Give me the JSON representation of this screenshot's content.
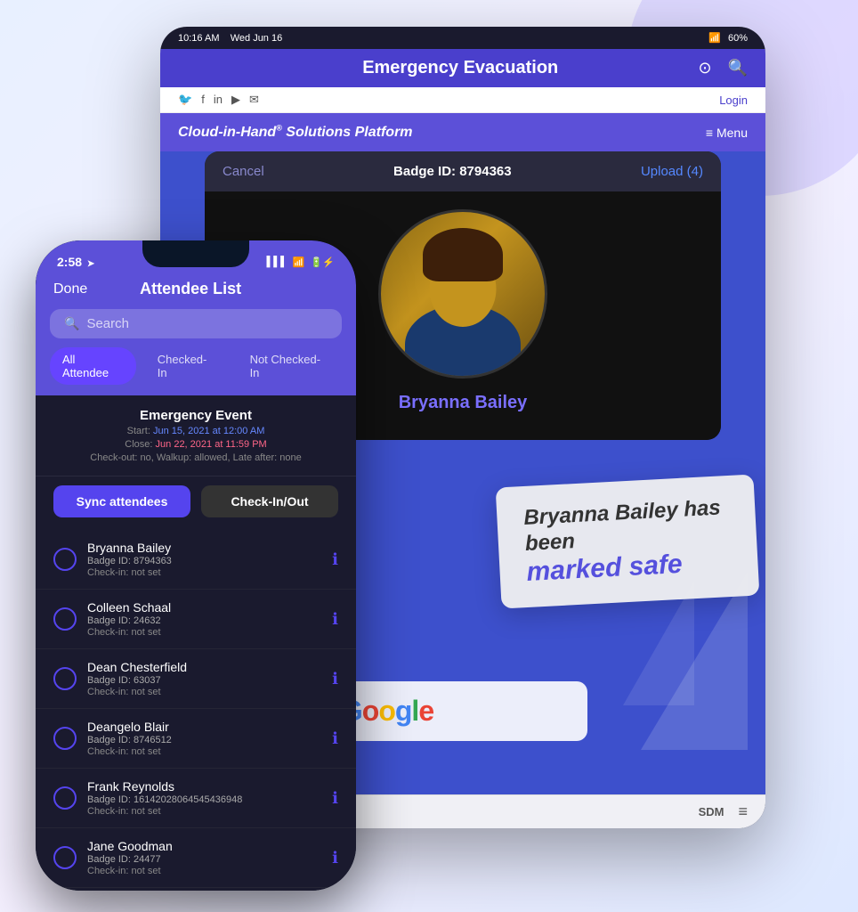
{
  "page": {
    "background": "#e8f0ff"
  },
  "tablet": {
    "status_bar": {
      "time": "10:16 AM",
      "date": "Wed Jun 16",
      "battery": "60%",
      "signal": "WiFi"
    },
    "nav": {
      "title": "Emergency Evacuation",
      "camera_icon": "📷",
      "search_icon": "🔍"
    },
    "social_bar": {
      "icons": [
        "twitter",
        "facebook",
        "linkedin",
        "youtube",
        "email"
      ],
      "login_label": "Login"
    },
    "brand_bar": {
      "name": "Cloud-in-Hand",
      "reg": "®",
      "subtitle": " Solutions Platform",
      "menu_label": "≡ Menu"
    },
    "badge_modal": {
      "cancel_label": "Cancel",
      "badge_id": "Badge ID: 8794363",
      "upload_label": "Upload (4)",
      "person_name": "Bryanna Bailey"
    },
    "marked_safe": {
      "line1": "Bryanna Bailey has been",
      "line2": "marked safe"
    },
    "bottom_bar": {
      "sdm_label": "SDM",
      "menu_icon": "≡"
    },
    "google_label": "Google"
  },
  "phone": {
    "status_bar": {
      "time": "2:58",
      "location_icon": "➤",
      "signal": "▌▌▌",
      "wifi": "WiFi",
      "battery": "⚡"
    },
    "nav": {
      "done_label": "Done",
      "title": "Attendee List"
    },
    "search": {
      "placeholder": "Search",
      "icon": "🔍"
    },
    "filter_tabs": [
      {
        "label": "All Attendee",
        "active": true
      },
      {
        "label": "Checked-In",
        "active": false
      },
      {
        "label": "Not Checked-In",
        "active": false
      }
    ],
    "event": {
      "title": "Emergency Event",
      "start_label": "Start:",
      "start_date": "Jun 15, 2021 at 12:00 AM",
      "close_label": "Close:",
      "close_date": "Jun 22, 2021 at 11:59 PM",
      "checkout_info": "Check-out: no, Walkup: allowed, Late after: none"
    },
    "action_buttons": {
      "sync_label": "Sync attendees",
      "checkin_label": "Check-In/Out"
    },
    "attendees": [
      {
        "name": "Bryanna Bailey",
        "badge_id": "Badge ID: 8794363",
        "checkin": "Check-in: not set"
      },
      {
        "name": "Colleen Schaal",
        "badge_id": "Badge ID: 24632",
        "checkin": "Check-in: not set"
      },
      {
        "name": "Dean Chesterfield",
        "badge_id": "Badge ID: 63037",
        "checkin": "Check-in: not set"
      },
      {
        "name": "Deangelo Blair",
        "badge_id": "Badge ID: 8746512",
        "checkin": "Check-in: not set"
      },
      {
        "name": "Frank Reynolds",
        "badge_id": "Badge ID: 16142028064545436948",
        "checkin": "Check-in: not set"
      },
      {
        "name": "Jane Goodman",
        "badge_id": "Badge ID: 24477",
        "checkin": "Check-in: not set"
      }
    ]
  }
}
